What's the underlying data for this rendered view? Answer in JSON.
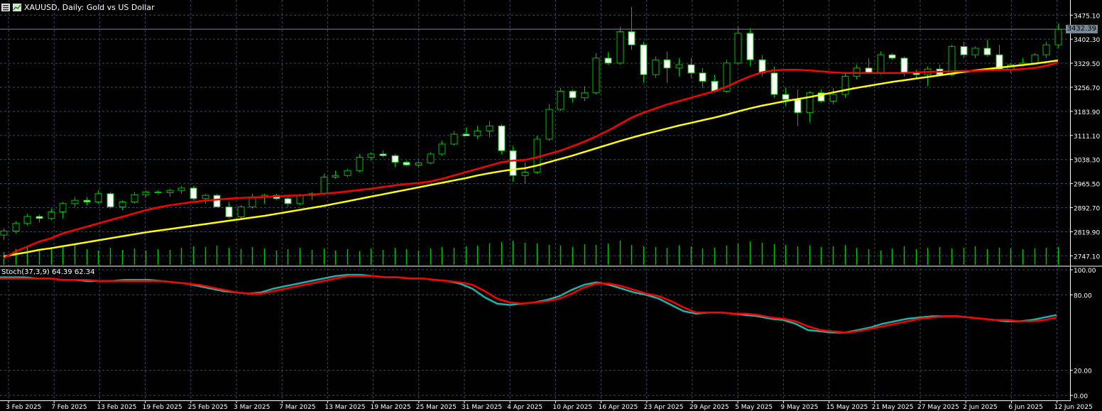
{
  "header": {
    "symbol_title": "XAUUSD, Daily:  Gold vs US Dollar",
    "icons": [
      "menu-icon",
      "chart-window-icon"
    ]
  },
  "price_axis": {
    "labels": [
      "3475.10",
      "3402.30",
      "3329.50",
      "3256.70",
      "3183.90",
      "3111.10",
      "3038.30",
      "2965.50",
      "2892.70",
      "2819.90",
      "2747.10"
    ],
    "current_price": "3432.39",
    "current_price_color": "#778899"
  },
  "stoch_axis": {
    "labels": [
      "100.00",
      "80.00",
      "20.00",
      "0.00"
    ]
  },
  "stochastic": {
    "label": "Stoch(37,3,9) 64.39 62.34"
  },
  "time_axis": {
    "labels": [
      "3 Feb 2025",
      "7 Feb 2025",
      "13 Feb 2025",
      "19 Feb 2025",
      "25 Feb 2025",
      "3 Mar 2025",
      "7 Mar 2025",
      "13 Mar 2025",
      "19 Mar 2025",
      "25 Mar 2025",
      "31 Mar 2025",
      "4 Apr 2025",
      "10 Apr 2025",
      "16 Apr 2025",
      "23 Apr 2025",
      "29 Apr 2025",
      "5 May 2025",
      "9 May 2025",
      "15 May 2025",
      "21 May 2025",
      "27 May 2025",
      "2 Jun 2025",
      "6 Jun 2025",
      "12 Jun 2025"
    ]
  },
  "colors": {
    "background": "#000000",
    "grid": "#3a4a5a",
    "bull_candle": "#00c000",
    "bear_candle": "#ffffff",
    "ma_fast": "#ff0000",
    "ma_slow": "#ffff00",
    "stoch_main": "#20b2aa",
    "stoch_signal": "#ff0000",
    "volume": "#00c000"
  },
  "chart_data": {
    "type": "candlestick",
    "symbol": "XAUUSD",
    "timeframe": "Daily",
    "candles": [
      [
        2810,
        2830,
        2795,
        2822
      ],
      [
        2822,
        2852,
        2815,
        2845
      ],
      [
        2845,
        2875,
        2838,
        2866
      ],
      [
        2866,
        2872,
        2848,
        2860
      ],
      [
        2860,
        2890,
        2855,
        2880
      ],
      [
        2880,
        2910,
        2860,
        2905
      ],
      [
        2905,
        2925,
        2895,
        2915
      ],
      [
        2915,
        2925,
        2900,
        2910
      ],
      [
        2910,
        2945,
        2905,
        2935
      ],
      [
        2935,
        2940,
        2890,
        2895
      ],
      [
        2895,
        2915,
        2885,
        2910
      ],
      [
        2910,
        2940,
        2905,
        2932
      ],
      [
        2932,
        2945,
        2925,
        2940
      ],
      [
        2940,
        2945,
        2935,
        2938
      ],
      [
        2938,
        2950,
        2925,
        2945
      ],
      [
        2945,
        2958,
        2935,
        2952
      ],
      [
        2952,
        2958,
        2915,
        2920
      ],
      [
        2920,
        2935,
        2905,
        2930
      ],
      [
        2930,
        2935,
        2895,
        2895
      ],
      [
        2895,
        2910,
        2860,
        2865
      ],
      [
        2865,
        2900,
        2860,
        2895
      ],
      [
        2895,
        2935,
        2890,
        2925
      ],
      [
        2925,
        2935,
        2905,
        2930
      ],
      [
        2930,
        2935,
        2915,
        2920
      ],
      [
        2920,
        2925,
        2895,
        2905
      ],
      [
        2905,
        2935,
        2900,
        2930
      ],
      [
        2930,
        2940,
        2915,
        2935
      ],
      [
        2935,
        2995,
        2930,
        2985
      ],
      [
        2985,
        3005,
        2980,
        2990
      ],
      [
        2990,
        3010,
        2985,
        3005
      ],
      [
        3005,
        3055,
        3000,
        3045
      ],
      [
        3045,
        3060,
        3035,
        3055
      ],
      [
        3055,
        3065,
        3045,
        3050
      ],
      [
        3050,
        3055,
        3015,
        3030
      ],
      [
        3030,
        3035,
        3018,
        3022
      ],
      [
        3022,
        3035,
        3015,
        3028
      ],
      [
        3028,
        3060,
        3025,
        3055
      ],
      [
        3055,
        3095,
        3050,
        3085
      ],
      [
        3085,
        3125,
        3080,
        3115
      ],
      [
        3115,
        3135,
        3108,
        3110
      ],
      [
        3110,
        3140,
        3100,
        3125
      ],
      [
        3125,
        3155,
        3105,
        3140
      ],
      [
        3140,
        3145,
        3055,
        3065
      ],
      [
        3065,
        3080,
        2970,
        2990
      ],
      [
        2990,
        3030,
        2965,
        3000
      ],
      [
        3000,
        3110,
        2995,
        3100
      ],
      [
        3100,
        3205,
        3095,
        3190
      ],
      [
        3190,
        3255,
        3185,
        3245
      ],
      [
        3245,
        3250,
        3210,
        3225
      ],
      [
        3225,
        3260,
        3215,
        3240
      ],
      [
        3240,
        3360,
        3235,
        3345
      ],
      [
        3345,
        3362,
        3325,
        3330
      ],
      [
        3330,
        3440,
        3325,
        3425
      ],
      [
        3425,
        3500,
        3370,
        3385
      ],
      [
        3385,
        3395,
        3270,
        3295
      ],
      [
        3295,
        3350,
        3285,
        3340
      ],
      [
        3340,
        3365,
        3270,
        3315
      ],
      [
        3315,
        3345,
        3290,
        3325
      ],
      [
        3325,
        3345,
        3285,
        3300
      ],
      [
        3300,
        3315,
        3255,
        3275
      ],
      [
        3275,
        3295,
        3240,
        3245
      ],
      [
        3245,
        3340,
        3240,
        3330
      ],
      [
        3330,
        3440,
        3325,
        3420
      ],
      [
        3420,
        3436,
        3320,
        3340
      ],
      [
        3340,
        3355,
        3290,
        3300
      ],
      [
        3300,
        3320,
        3225,
        3235
      ],
      [
        3235,
        3255,
        3200,
        3220
      ],
      [
        3220,
        3250,
        3140,
        3180
      ],
      [
        3180,
        3245,
        3150,
        3240
      ],
      [
        3240,
        3250,
        3210,
        3215
      ],
      [
        3215,
        3255,
        3205,
        3235
      ],
      [
        3235,
        3300,
        3225,
        3290
      ],
      [
        3290,
        3325,
        3280,
        3315
      ],
      [
        3315,
        3345,
        3300,
        3300
      ],
      [
        3300,
        3365,
        3295,
        3355
      ],
      [
        3355,
        3360,
        3340,
        3345
      ],
      [
        3345,
        3350,
        3290,
        3300
      ],
      [
        3300,
        3310,
        3280,
        3295
      ],
      [
        3295,
        3320,
        3260,
        3312
      ],
      [
        3312,
        3325,
        3290,
        3295
      ],
      [
        3295,
        3385,
        3290,
        3380
      ],
      [
        3380,
        3395,
        3345,
        3355
      ],
      [
        3355,
        3380,
        3345,
        3375
      ],
      [
        3375,
        3400,
        3350,
        3355
      ],
      [
        3355,
        3385,
        3305,
        3310
      ],
      [
        3310,
        3330,
        3300,
        3325
      ],
      [
        3325,
        3345,
        3320,
        3330
      ],
      [
        3330,
        3360,
        3325,
        3355
      ],
      [
        3355,
        3395,
        3345,
        3385
      ],
      [
        3385,
        3450,
        3375,
        3432
      ]
    ],
    "ma_fast_values": [
      2740,
      2760,
      2775,
      2790,
      2800,
      2815,
      2825,
      2835,
      2845,
      2855,
      2865,
      2875,
      2885,
      2893,
      2900,
      2905,
      2910,
      2914,
      2917,
      2920,
      2922,
      2924,
      2925,
      2927,
      2929,
      2930,
      2932,
      2935,
      2938,
      2942,
      2946,
      2950,
      2955,
      2960,
      2964,
      2967,
      2972,
      2980,
      2990,
      3000,
      3010,
      3020,
      3030,
      3035,
      3037,
      3045,
      3055,
      3065,
      3078,
      3092,
      3108,
      3125,
      3145,
      3165,
      3180,
      3192,
      3205,
      3215,
      3225,
      3235,
      3245,
      3258,
      3275,
      3290,
      3302,
      3308,
      3310,
      3310,
      3308,
      3305,
      3302,
      3300,
      3300,
      3300,
      3300,
      3300,
      3300,
      3302,
      3303,
      3304,
      3305,
      3306,
      3307,
      3308,
      3310,
      3310,
      3312,
      3315,
      3322,
      3332
    ],
    "ma_slow_values": [
      2745,
      2752,
      2758,
      2765,
      2770,
      2776,
      2782,
      2788,
      2794,
      2800,
      2806,
      2812,
      2818,
      2823,
      2828,
      2833,
      2838,
      2843,
      2848,
      2853,
      2858,
      2863,
      2868,
      2874,
      2880,
      2886,
      2892,
      2898,
      2905,
      2912,
      2919,
      2926,
      2933,
      2940,
      2947,
      2954,
      2961,
      2968,
      2975,
      2982,
      2990,
      2997,
      3003,
      3008,
      3012,
      3020,
      3030,
      3040,
      3050,
      3061,
      3072,
      3083,
      3094,
      3104,
      3114,
      3123,
      3132,
      3141,
      3149,
      3157,
      3165,
      3174,
      3184,
      3193,
      3201,
      3208,
      3215,
      3221,
      3227,
      3234,
      3241,
      3248,
      3255,
      3261,
      3267,
      3273,
      3278,
      3283,
      3288,
      3293,
      3298,
      3303,
      3308,
      3312,
      3316,
      3320,
      3324,
      3328,
      3333,
      3338
    ],
    "volume": [
      18,
      22,
      25,
      20,
      24,
      26,
      28,
      22,
      20,
      24,
      21,
      23,
      20,
      22,
      21,
      24,
      26,
      25,
      27,
      24,
      22,
      25,
      23,
      20,
      22,
      24,
      21,
      23,
      20,
      22,
      19,
      23,
      21,
      24,
      22,
      20,
      23,
      25,
      24,
      26,
      27,
      30,
      32,
      34,
      31,
      30,
      28,
      27,
      25,
      29,
      28,
      30,
      34,
      28,
      26,
      25,
      24,
      27,
      26,
      23,
      24,
      27,
      30,
      33,
      31,
      29,
      28,
      26,
      27,
      25,
      26,
      28,
      24,
      22,
      20,
      23,
      26,
      22,
      24,
      25,
      23,
      24,
      26,
      22,
      24,
      23,
      22,
      23,
      24,
      25
    ],
    "stoch_main": [
      94,
      94,
      94,
      93,
      93,
      92,
      92,
      91,
      91,
      91,
      92,
      92,
      92,
      91,
      90,
      89,
      87,
      85,
      83,
      82,
      81,
      82,
      85,
      87,
      89,
      91,
      93,
      95,
      96,
      96,
      95,
      94,
      94,
      93,
      93,
      92,
      91,
      89,
      85,
      78,
      73,
      72,
      73,
      74,
      76,
      79,
      84,
      88,
      90,
      88,
      85,
      82,
      80,
      77,
      72,
      67,
      65,
      66,
      66,
      65,
      64,
      63,
      61,
      60,
      57,
      52,
      51,
      50,
      50,
      52,
      54,
      57,
      59,
      61,
      62,
      63,
      63,
      63,
      62,
      61,
      60,
      59,
      59,
      60,
      62,
      64
    ],
    "stoch_signal": [
      93,
      93,
      93,
      93,
      93,
      92,
      92,
      92,
      91,
      91,
      91,
      91,
      91,
      91,
      90,
      89,
      88,
      86,
      84,
      82,
      81,
      81,
      83,
      85,
      87,
      89,
      91,
      93,
      95,
      95,
      95,
      94,
      94,
      93,
      93,
      92,
      91,
      90,
      88,
      83,
      77,
      74,
      73,
      74,
      75,
      77,
      81,
      86,
      89,
      89,
      87,
      84,
      81,
      79,
      75,
      70,
      66,
      66,
      66,
      65,
      65,
      64,
      62,
      61,
      59,
      55,
      52,
      51,
      50,
      51,
      53,
      55,
      57,
      59,
      61,
      62,
      63,
      63,
      62,
      61,
      60,
      60,
      59,
      59,
      60,
      62
    ],
    "price_range": [
      2720,
      3510
    ],
    "stoch_range": [
      0,
      100
    ],
    "grid": true
  }
}
